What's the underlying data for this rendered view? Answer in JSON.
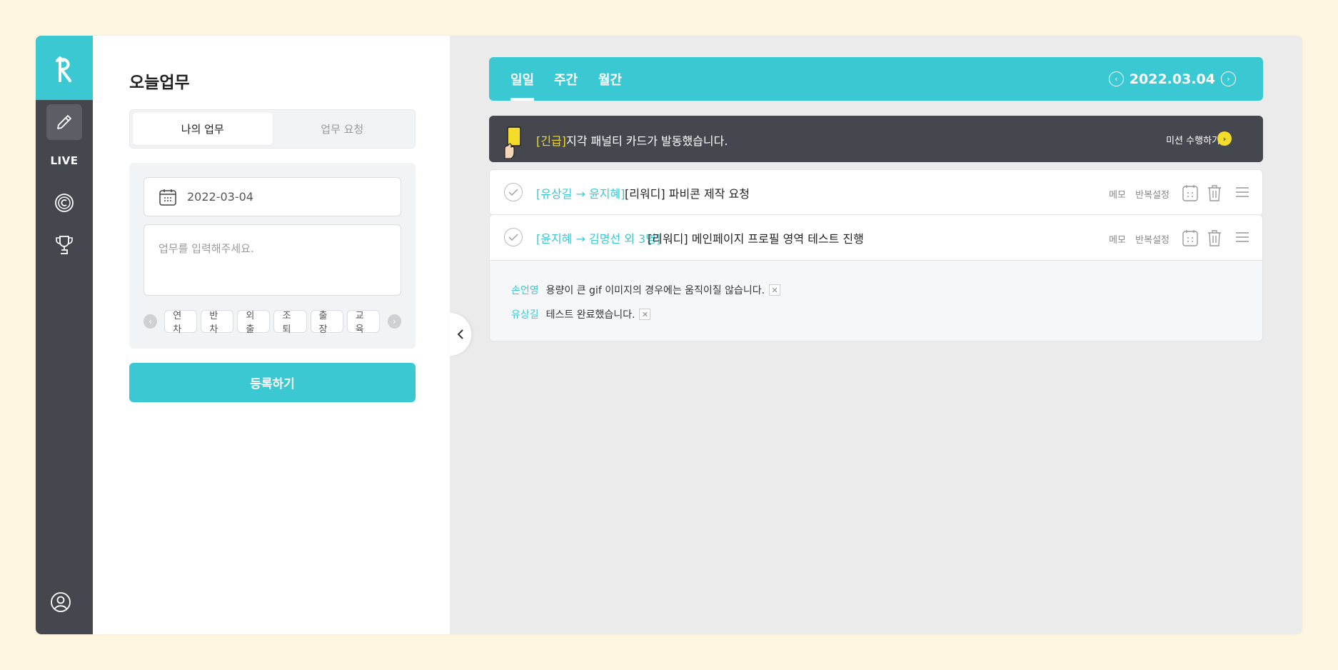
{
  "rail": {
    "live_label": "LIVE"
  },
  "panel": {
    "title": "오늘업무",
    "tabs": [
      "나의 업무",
      "업무 요청"
    ],
    "date_value": "2022-03-04",
    "input_placeholder": "업무를 입력해주세요.",
    "chips": [
      "연차",
      "반차",
      "외출",
      "조퇴",
      "출장",
      "교육"
    ],
    "submit_label": "등록하기"
  },
  "main": {
    "view_tabs": [
      "일일",
      "주간",
      "월간"
    ],
    "current_date": "2022.03.04",
    "banner": {
      "tag": "[긴급]",
      "message": "지각 패널티 카드가 발동했습니다.",
      "action": "미션 수행하기"
    },
    "tasks": [
      {
        "assign": "[유상길 → 윤지혜]",
        "title": "[리워디] 파비콘 제작 요청",
        "memo": "메모",
        "repeat": "반복설정"
      },
      {
        "assign": "[윤지혜 → 김명선 외 3명]",
        "title": "[리워디] 메인페이지 프로필 영역 테스트 진행",
        "memo": "메모",
        "repeat": "반복설정",
        "comments": [
          {
            "name": "손언영",
            "text": "용량이 큰 gif 이미지의 경우에는 움직이질 않습니다."
          },
          {
            "name": "유상길",
            "text": "테스트 완료했습니다."
          }
        ]
      }
    ]
  },
  "colors": {
    "accent": "#3ac8d3",
    "dark": "#45474f",
    "warning": "#f4dc2a",
    "background": "#fdf5e0"
  }
}
